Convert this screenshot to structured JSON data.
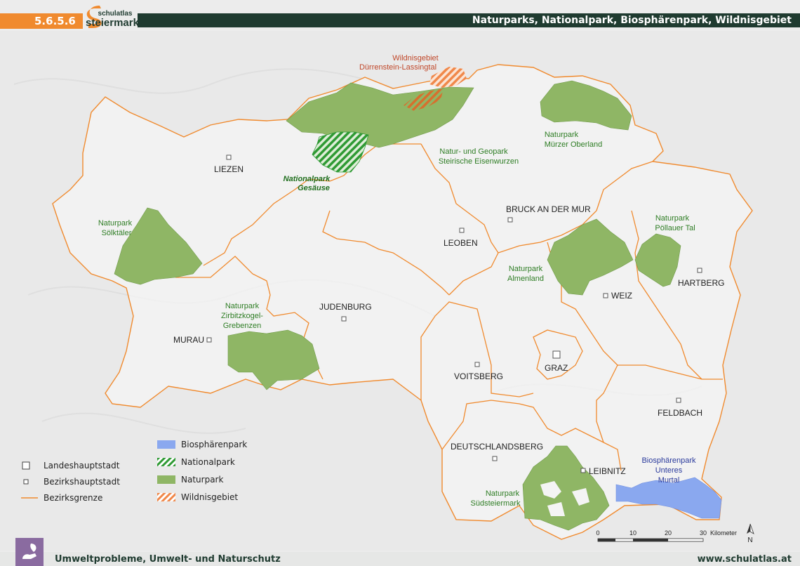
{
  "header": {
    "section_number": "5.6.5.6",
    "logo_text_top": "schulatlas",
    "logo_text_bottom": "steiermark",
    "logo_letter": "S",
    "title": "Naturparks, Nationalpark, Biosphärenpark, Wildnisgebiet"
  },
  "colors": {
    "accent_orange": "#f08a2e",
    "header_dark": "#1f3b30",
    "naturpark_green": "#8fb665",
    "nationalpark_green": "#2f9a34",
    "biosphere_blue": "#8aa8ef",
    "wilderness_orange": "#f0884a",
    "border_orange": "#f08a2e",
    "label_green": "#2e7d24",
    "label_blue": "#2a3a9c",
    "label_red": "#c0482a"
  },
  "map": {
    "cities": [
      {
        "name": "LIEZEN",
        "type": "bezirk"
      },
      {
        "name": "LEOBEN",
        "type": "bezirk"
      },
      {
        "name": "BRUCK AN DER MUR",
        "type": "bezirk"
      },
      {
        "name": "JUDENBURG",
        "type": "bezirk"
      },
      {
        "name": "MURAU",
        "type": "bezirk"
      },
      {
        "name": "WEIZ",
        "type": "bezirk"
      },
      {
        "name": "HARTBERG",
        "type": "bezirk"
      },
      {
        "name": "GRAZ",
        "type": "landes"
      },
      {
        "name": "VOITSBERG",
        "type": "bezirk"
      },
      {
        "name": "FELDBACH",
        "type": "bezirk"
      },
      {
        "name": "DEUTSCHLANDSBERG",
        "type": "bezirk"
      },
      {
        "name": "LEIBNITZ",
        "type": "bezirk"
      }
    ],
    "areas": {
      "wildnis": [
        "Wildnisgebiet",
        "Dürrenstein-Lassingtal"
      ],
      "gesaeuse": [
        "Nationalpark",
        "Gesäuse"
      ],
      "eisenwurzen": [
        "Natur- und Geopark",
        "Steirische Eisenwurzen"
      ],
      "muerzer": [
        "Naturpark",
        "Mürzer Oberland"
      ],
      "soelktaeler": [
        "Naturpark",
        "Sölktäler"
      ],
      "poellauer": [
        "Naturpark",
        "Pöllauer Tal"
      ],
      "almenland": [
        "Naturpark",
        "Almenland"
      ],
      "zirbitz": [
        "Naturpark",
        "Zirbitzkogel-",
        "Grebenzen"
      ],
      "suedsteier": [
        "Naturpark",
        "Südsteiermark"
      ],
      "biosphaere": [
        "Biosphärenpark",
        "Unteres",
        "Murtal"
      ]
    },
    "scale": {
      "ticks": [
        "0",
        "10",
        "20",
        "30"
      ],
      "unit": "Kilometer",
      "north": "N"
    }
  },
  "legend_symbols": [
    {
      "label": "Landeshauptstadt",
      "symbol": "square-large-icon"
    },
    {
      "label": "Bezirkshauptstadt",
      "symbol": "square-small-icon"
    },
    {
      "label": "Bezirksgrenze",
      "symbol": "orange-line-icon"
    }
  ],
  "legend_areas": [
    {
      "label": "Biosphärenpark",
      "fill": "blue"
    },
    {
      "label": "Nationalpark",
      "fill": "green-hatch"
    },
    {
      "label": "Naturpark",
      "fill": "green"
    },
    {
      "label": "Wildnisgebiet",
      "fill": "orange-hatch"
    }
  ],
  "footer": {
    "topic": "Umweltprobleme, Umwelt- und Naturschutz",
    "website": "www.schulatlas.at"
  }
}
